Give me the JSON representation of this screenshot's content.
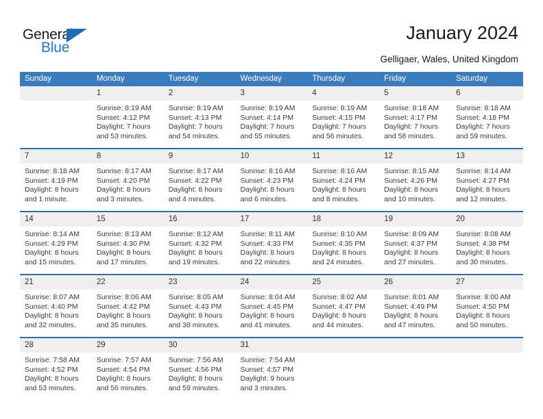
{
  "logo": {
    "word_top": "General",
    "word_bottom": "Blue",
    "accent_color": "#1f6eb5",
    "blue_text_color": "#2277c8"
  },
  "header": {
    "title": "January 2024",
    "subtitle": "Gelligaer, Wales, United Kingdom",
    "header_bg": "#3a7cbe",
    "separator_color": "#2d6da4",
    "datenum_bg": "#efefef"
  },
  "columns": [
    "Sunday",
    "Monday",
    "Tuesday",
    "Wednesday",
    "Thursday",
    "Friday",
    "Saturday"
  ],
  "labels": {
    "sunrise": "Sunrise:",
    "sunset": "Sunset:",
    "daylight": "Daylight:"
  },
  "weeks": [
    [
      {
        "day": "",
        "sunrise": "",
        "sunset": "",
        "daylight_1": "",
        "daylight_2": ""
      },
      {
        "day": "1",
        "sunrise": "Sunrise: 8:19 AM",
        "sunset": "Sunset: 4:12 PM",
        "daylight_1": "Daylight: 7 hours",
        "daylight_2": "and 53 minutes."
      },
      {
        "day": "2",
        "sunrise": "Sunrise: 8:19 AM",
        "sunset": "Sunset: 4:13 PM",
        "daylight_1": "Daylight: 7 hours",
        "daylight_2": "and 54 minutes."
      },
      {
        "day": "3",
        "sunrise": "Sunrise: 8:19 AM",
        "sunset": "Sunset: 4:14 PM",
        "daylight_1": "Daylight: 7 hours",
        "daylight_2": "and 55 minutes."
      },
      {
        "day": "4",
        "sunrise": "Sunrise: 8:19 AM",
        "sunset": "Sunset: 4:15 PM",
        "daylight_1": "Daylight: 7 hours",
        "daylight_2": "and 56 minutes."
      },
      {
        "day": "5",
        "sunrise": "Sunrise: 8:18 AM",
        "sunset": "Sunset: 4:17 PM",
        "daylight_1": "Daylight: 7 hours",
        "daylight_2": "and 58 minutes."
      },
      {
        "day": "6",
        "sunrise": "Sunrise: 8:18 AM",
        "sunset": "Sunset: 4:18 PM",
        "daylight_1": "Daylight: 7 hours",
        "daylight_2": "and 59 minutes."
      }
    ],
    [
      {
        "day": "7",
        "sunrise": "Sunrise: 8:18 AM",
        "sunset": "Sunset: 4:19 PM",
        "daylight_1": "Daylight: 8 hours",
        "daylight_2": "and 1 minute."
      },
      {
        "day": "8",
        "sunrise": "Sunrise: 8:17 AM",
        "sunset": "Sunset: 4:20 PM",
        "daylight_1": "Daylight: 8 hours",
        "daylight_2": "and 3 minutes."
      },
      {
        "day": "9",
        "sunrise": "Sunrise: 8:17 AM",
        "sunset": "Sunset: 4:22 PM",
        "daylight_1": "Daylight: 8 hours",
        "daylight_2": "and 4 minutes."
      },
      {
        "day": "10",
        "sunrise": "Sunrise: 8:16 AM",
        "sunset": "Sunset: 4:23 PM",
        "daylight_1": "Daylight: 8 hours",
        "daylight_2": "and 6 minutes."
      },
      {
        "day": "11",
        "sunrise": "Sunrise: 8:16 AM",
        "sunset": "Sunset: 4:24 PM",
        "daylight_1": "Daylight: 8 hours",
        "daylight_2": "and 8 minutes."
      },
      {
        "day": "12",
        "sunrise": "Sunrise: 8:15 AM",
        "sunset": "Sunset: 4:26 PM",
        "daylight_1": "Daylight: 8 hours",
        "daylight_2": "and 10 minutes."
      },
      {
        "day": "13",
        "sunrise": "Sunrise: 8:14 AM",
        "sunset": "Sunset: 4:27 PM",
        "daylight_1": "Daylight: 8 hours",
        "daylight_2": "and 12 minutes."
      }
    ],
    [
      {
        "day": "14",
        "sunrise": "Sunrise: 8:14 AM",
        "sunset": "Sunset: 4:29 PM",
        "daylight_1": "Daylight: 8 hours",
        "daylight_2": "and 15 minutes."
      },
      {
        "day": "15",
        "sunrise": "Sunrise: 8:13 AM",
        "sunset": "Sunset: 4:30 PM",
        "daylight_1": "Daylight: 8 hours",
        "daylight_2": "and 17 minutes."
      },
      {
        "day": "16",
        "sunrise": "Sunrise: 8:12 AM",
        "sunset": "Sunset: 4:32 PM",
        "daylight_1": "Daylight: 8 hours",
        "daylight_2": "and 19 minutes."
      },
      {
        "day": "17",
        "sunrise": "Sunrise: 8:11 AM",
        "sunset": "Sunset: 4:33 PM",
        "daylight_1": "Daylight: 8 hours",
        "daylight_2": "and 22 minutes."
      },
      {
        "day": "18",
        "sunrise": "Sunrise: 8:10 AM",
        "sunset": "Sunset: 4:35 PM",
        "daylight_1": "Daylight: 8 hours",
        "daylight_2": "and 24 minutes."
      },
      {
        "day": "19",
        "sunrise": "Sunrise: 8:09 AM",
        "sunset": "Sunset: 4:37 PM",
        "daylight_1": "Daylight: 8 hours",
        "daylight_2": "and 27 minutes."
      },
      {
        "day": "20",
        "sunrise": "Sunrise: 8:08 AM",
        "sunset": "Sunset: 4:38 PM",
        "daylight_1": "Daylight: 8 hours",
        "daylight_2": "and 30 minutes."
      }
    ],
    [
      {
        "day": "21",
        "sunrise": "Sunrise: 8:07 AM",
        "sunset": "Sunset: 4:40 PM",
        "daylight_1": "Daylight: 8 hours",
        "daylight_2": "and 32 minutes."
      },
      {
        "day": "22",
        "sunrise": "Sunrise: 8:06 AM",
        "sunset": "Sunset: 4:42 PM",
        "daylight_1": "Daylight: 8 hours",
        "daylight_2": "and 35 minutes."
      },
      {
        "day": "23",
        "sunrise": "Sunrise: 8:05 AM",
        "sunset": "Sunset: 4:43 PM",
        "daylight_1": "Daylight: 8 hours",
        "daylight_2": "and 38 minutes."
      },
      {
        "day": "24",
        "sunrise": "Sunrise: 8:04 AM",
        "sunset": "Sunset: 4:45 PM",
        "daylight_1": "Daylight: 8 hours",
        "daylight_2": "and 41 minutes."
      },
      {
        "day": "25",
        "sunrise": "Sunrise: 8:02 AM",
        "sunset": "Sunset: 4:47 PM",
        "daylight_1": "Daylight: 8 hours",
        "daylight_2": "and 44 minutes."
      },
      {
        "day": "26",
        "sunrise": "Sunrise: 8:01 AM",
        "sunset": "Sunset: 4:49 PM",
        "daylight_1": "Daylight: 8 hours",
        "daylight_2": "and 47 minutes."
      },
      {
        "day": "27",
        "sunrise": "Sunrise: 8:00 AM",
        "sunset": "Sunset: 4:50 PM",
        "daylight_1": "Daylight: 8 hours",
        "daylight_2": "and 50 minutes."
      }
    ],
    [
      {
        "day": "28",
        "sunrise": "Sunrise: 7:58 AM",
        "sunset": "Sunset: 4:52 PM",
        "daylight_1": "Daylight: 8 hours",
        "daylight_2": "and 53 minutes."
      },
      {
        "day": "29",
        "sunrise": "Sunrise: 7:57 AM",
        "sunset": "Sunset: 4:54 PM",
        "daylight_1": "Daylight: 8 hours",
        "daylight_2": "and 56 minutes."
      },
      {
        "day": "30",
        "sunrise": "Sunrise: 7:56 AM",
        "sunset": "Sunset: 4:56 PM",
        "daylight_1": "Daylight: 8 hours",
        "daylight_2": "and 59 minutes."
      },
      {
        "day": "31",
        "sunrise": "Sunrise: 7:54 AM",
        "sunset": "Sunset: 4:57 PM",
        "daylight_1": "Daylight: 9 hours",
        "daylight_2": "and 3 minutes."
      },
      {
        "day": "",
        "sunrise": "",
        "sunset": "",
        "daylight_1": "",
        "daylight_2": ""
      },
      {
        "day": "",
        "sunrise": "",
        "sunset": "",
        "daylight_1": "",
        "daylight_2": ""
      },
      {
        "day": "",
        "sunrise": "",
        "sunset": "",
        "daylight_1": "",
        "daylight_2": ""
      }
    ]
  ]
}
